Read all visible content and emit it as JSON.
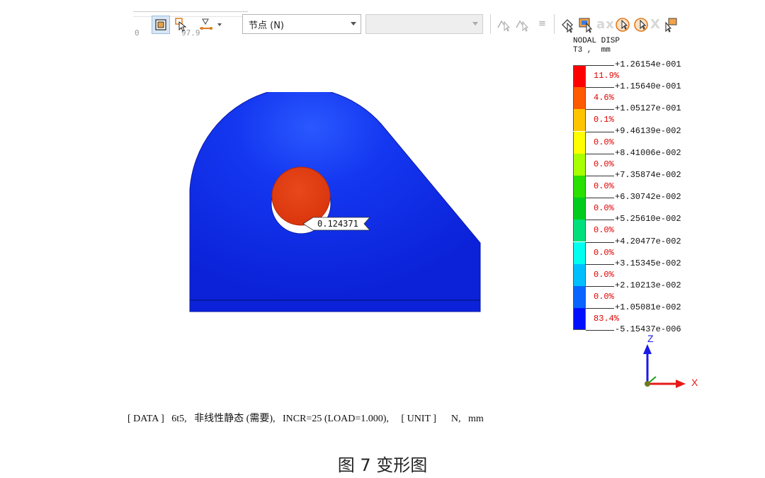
{
  "toolbar": {
    "slider_min": "0",
    "slider_max": "97.9",
    "entity_select": "节点 (N)",
    "second_select": "",
    "ghost_text": "ax",
    "equals_glyph": "≡",
    "icons": [
      "fit-view-icon",
      "deform-icon",
      "node-icon",
      "probe-icon",
      "select-icon",
      "rotate-icon",
      "pick-icon"
    ]
  },
  "model": {
    "probe_value": "0.124371",
    "body_color": "#0f2fe0",
    "hole_color": "#e03b12"
  },
  "legend": {
    "title_line1": "NODAL DISP",
    "title_line2": "T3 ,  mm",
    "values": [
      "+1.26154e-001",
      "+1.15640e-001",
      "+1.05127e-001",
      "+9.46139e-002",
      "+8.41006e-002",
      "+7.35874e-002",
      "+6.30742e-002",
      "+5.25610e-002",
      "+4.20477e-002",
      "+3.15345e-002",
      "+2.10213e-002",
      "+1.05081e-002",
      "-5.15437e-006"
    ],
    "percentages": [
      "11.9%",
      "4.6%",
      "0.1%",
      "0.0%",
      "0.0%",
      "0.0%",
      "0.0%",
      "0.0%",
      "0.0%",
      "0.0%",
      "0.0%",
      "83.4%"
    ],
    "colors": [
      "#ff0000",
      "#ff5a00",
      "#ffc400",
      "#ffff00",
      "#a8ff00",
      "#29e000",
      "#00cc1e",
      "#00e07a",
      "#00ffee",
      "#00bfff",
      "#0a64ff",
      "#0010ff"
    ]
  },
  "axes": {
    "z_label": "Z",
    "x_label": "X",
    "z_color": "#1a1ae6",
    "x_color": "#e61a1a"
  },
  "status_line": "[ DATA ]   6t5,   非线性静态 (需要),   INCR=25 (LOAD=1.000),     [ UNIT ]      N,   mm",
  "caption": "图 7 变形图"
}
